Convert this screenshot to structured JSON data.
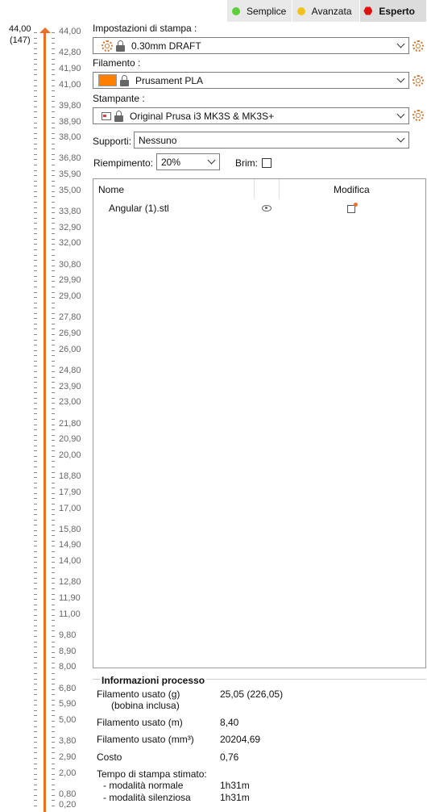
{
  "modes": [
    {
      "label": "Semplice",
      "color": "#5ccf3a",
      "shape": "dot"
    },
    {
      "label": "Avanzata",
      "color": "#f2c21b",
      "shape": "dot"
    },
    {
      "label": "Esperto",
      "color": "#e0100f",
      "shape": "hex",
      "active": true
    }
  ],
  "slider": {
    "top_value": "44,00",
    "top_layer": "(147)",
    "labels": [
      "44,00",
      "42,80",
      "41,90",
      "41,00",
      "39,80",
      "38,90",
      "38,00",
      "36,80",
      "35,90",
      "35,00",
      "33,80",
      "32,90",
      "32,00",
      "30,80",
      "29,90",
      "29,00",
      "27,80",
      "26,90",
      "26,00",
      "24,80",
      "23,90",
      "23,00",
      "21,80",
      "20,90",
      "20,00",
      "18,80",
      "17,90",
      "17,00",
      "15,80",
      "14,90",
      "14,00",
      "12,80",
      "11,90",
      "11,00",
      "9,80",
      "8,90",
      "8,00",
      "6,80",
      "5,90",
      "5,00",
      "3,80",
      "2,90",
      "2,00",
      "0,80",
      "0,20"
    ]
  },
  "print_settings": {
    "label": "Impostazioni di stampa :",
    "value": "0.30mm DRAFT"
  },
  "filament": {
    "label": "Filamento :",
    "value": "Prusament PLA",
    "color": "#ff8000"
  },
  "printer": {
    "label": "Stampante :",
    "value": "Original Prusa i3 MK3S & MK3S+"
  },
  "supports": {
    "label": "Supporti:",
    "value": "Nessuno"
  },
  "infill": {
    "label": "Riempimento:",
    "value": "20%"
  },
  "brim": {
    "label": "Brim:"
  },
  "object_list": {
    "col_name": "Nome",
    "col_edit": "Modifica",
    "rows": [
      {
        "name": "Angular (1).stl"
      }
    ]
  },
  "info": {
    "title": "Informazioni processo",
    "rows": [
      {
        "label": "Filamento usato (g)",
        "value": "25,05 (226,05)"
      },
      {
        "label": "(bobina inclusa)",
        "value": ""
      },
      {
        "label": "Filamento usato (m)",
        "value": "8,40"
      },
      {
        "label": "Filamento usato (mm³)",
        "value": "20204,69"
      },
      {
        "label": "Costo",
        "value": "0,76"
      },
      {
        "label": "Tempo di stampa stimato:",
        "value": ""
      },
      {
        "label": "- modalità normale",
        "value": "1h31m"
      },
      {
        "label": "- modalità silenziosa",
        "value": "1h31m"
      }
    ]
  }
}
